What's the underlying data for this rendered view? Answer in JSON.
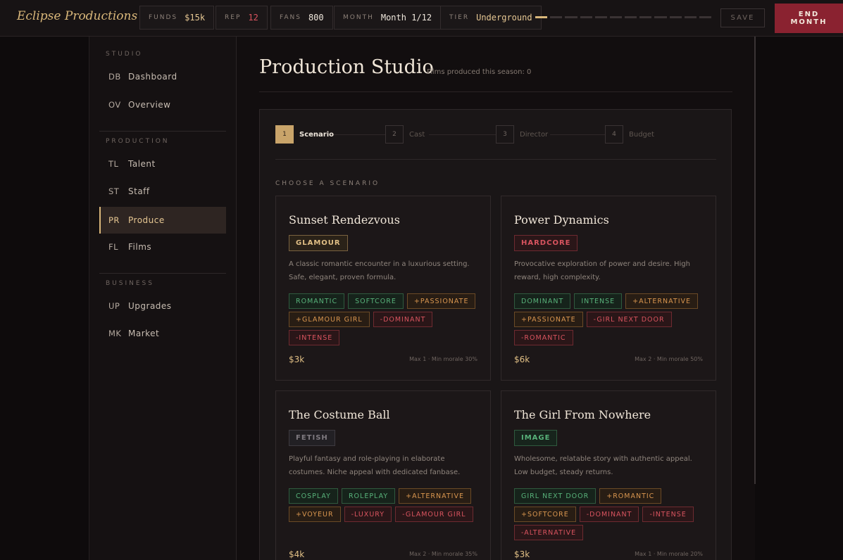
{
  "brand": "Eclipse Productions",
  "stats": {
    "funds": {
      "label": "FUNDS",
      "value": "$15k"
    },
    "rep": {
      "label": "REP",
      "value": "12"
    },
    "fans": {
      "label": "FANS",
      "value": "800"
    },
    "month": {
      "label": "MONTH",
      "value": "Month 1/12"
    },
    "tier": {
      "label": "TIER",
      "value": "Underground"
    }
  },
  "season_progress": {
    "current": 1,
    "total": 12
  },
  "save_label": "SAVE",
  "end_month_label": "END\nMONTH",
  "sidebar": {
    "sections": [
      {
        "title": "STUDIO",
        "items": [
          {
            "code": "DB",
            "label": "Dashboard"
          },
          {
            "code": "OV",
            "label": "Overview"
          }
        ]
      },
      {
        "title": "PRODUCTION",
        "items": [
          {
            "code": "TL",
            "label": "Talent"
          },
          {
            "code": "ST",
            "label": "Staff"
          },
          {
            "code": "PR",
            "label": "Produce"
          },
          {
            "code": "FL",
            "label": "Films"
          }
        ]
      },
      {
        "title": "BUSINESS",
        "items": [
          {
            "code": "UP",
            "label": "Upgrades"
          },
          {
            "code": "MK",
            "label": "Market"
          }
        ]
      }
    ],
    "active": "Produce"
  },
  "page": {
    "title": "Production Studio",
    "subtitle": "Films produced this season: 0"
  },
  "steps": [
    {
      "num": "1",
      "label": "Scenario"
    },
    {
      "num": "2",
      "label": "Cast"
    },
    {
      "num": "3",
      "label": "Director"
    },
    {
      "num": "4",
      "label": "Budget"
    }
  ],
  "choose_label": "CHOOSE A SCENARIO",
  "scenarios": [
    {
      "title": "Sunset Rendezvous",
      "genre": "GLAMOUR",
      "description": "A classic romantic encounter in a luxurious setting. Safe, elegant, proven formula.",
      "tags": [
        {
          "text": "ROMANTIC",
          "kind": "green"
        },
        {
          "text": "SOFTCORE",
          "kind": "green"
        },
        {
          "text": "+PASSIONATE",
          "kind": "orange"
        },
        {
          "text": "+GLAMOUR GIRL",
          "kind": "orange"
        },
        {
          "text": "-DOMINANT",
          "kind": "red"
        },
        {
          "text": "-INTENSE",
          "kind": "red"
        }
      ],
      "cost": "$3k",
      "meta": "Max 1 · Min morale 30%"
    },
    {
      "title": "Power Dynamics",
      "genre": "HARDCORE",
      "description": "Provocative exploration of power and desire. High reward, high complexity.",
      "tags": [
        {
          "text": "DOMINANT",
          "kind": "green"
        },
        {
          "text": "INTENSE",
          "kind": "green"
        },
        {
          "text": "+ALTERNATIVE",
          "kind": "orange"
        },
        {
          "text": "+PASSIONATE",
          "kind": "orange"
        },
        {
          "text": "-GIRL NEXT DOOR",
          "kind": "red"
        },
        {
          "text": "-ROMANTIC",
          "kind": "red"
        }
      ],
      "cost": "$6k",
      "meta": "Max 2 · Min morale 50%"
    },
    {
      "title": "The Costume Ball",
      "genre": "FETISH",
      "description": "Playful fantasy and role-playing in elaborate costumes. Niche appeal with dedicated fanbase.",
      "tags": [
        {
          "text": "COSPLAY",
          "kind": "green"
        },
        {
          "text": "ROLEPLAY",
          "kind": "green"
        },
        {
          "text": "+ALTERNATIVE",
          "kind": "orange"
        },
        {
          "text": "+VOYEUR",
          "kind": "orange"
        },
        {
          "text": "-LUXURY",
          "kind": "red"
        },
        {
          "text": "-GLAMOUR GIRL",
          "kind": "red"
        }
      ],
      "cost": "$4k",
      "meta": "Max 2 · Min morale 35%"
    },
    {
      "title": "The Girl From Nowhere",
      "genre": "IMAGE",
      "description": "Wholesome, relatable story with authentic appeal. Low budget, steady returns.",
      "tags": [
        {
          "text": "GIRL NEXT DOOR",
          "kind": "green"
        },
        {
          "text": "+ROMANTIC",
          "kind": "orange"
        },
        {
          "text": "+SOFTCORE",
          "kind": "orange"
        },
        {
          "text": "-DOMINANT",
          "kind": "red"
        },
        {
          "text": "-INTENSE",
          "kind": "red"
        },
        {
          "text": "-ALTERNATIVE",
          "kind": "red"
        }
      ],
      "cost": "$3k",
      "meta": "Max 1 · Min morale 20%"
    }
  ],
  "colors": {
    "accent": "#d9b77a",
    "end_month": "#8a2230",
    "positive": "#58b27a",
    "bonus": "#d9964f",
    "negative": "#d9545f"
  }
}
